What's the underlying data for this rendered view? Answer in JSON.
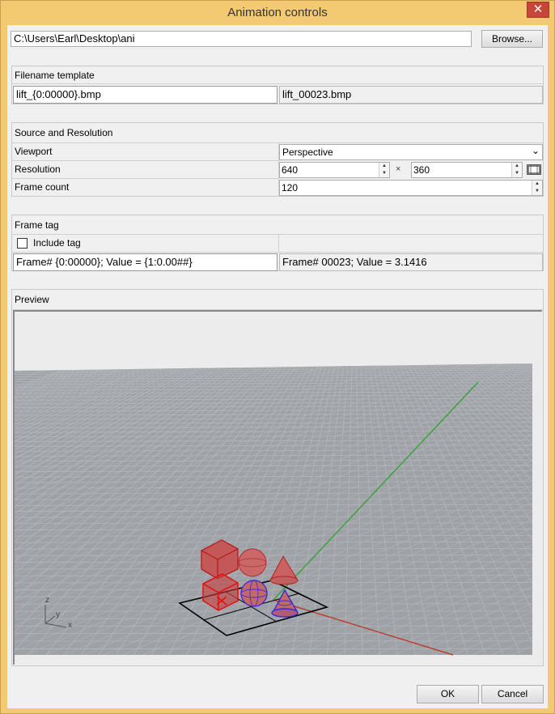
{
  "window": {
    "title": "Animation controls",
    "close_glyph": "✕"
  },
  "folder": {
    "path": "C:\\Users\\Earl\\Desktop\\ani",
    "browse_label": "Browse..."
  },
  "filename_template": {
    "header": "Filename template",
    "template_value": "lift_{0:00000}.bmp",
    "preview_value": "lift_00023.bmp"
  },
  "source": {
    "header": "Source and Resolution",
    "viewport_label": "Viewport",
    "viewport_value": "Perspective",
    "resolution_label": "Resolution",
    "width_value": "640",
    "times_sign": "×",
    "height_value": "360",
    "frame_count_label": "Frame count",
    "frame_count_value": "120"
  },
  "frame_tag": {
    "header": "Frame tag",
    "include_label": "Include tag",
    "include_checked": false,
    "format_value": "Frame# {0:00000};   Value = {1:0.00##}",
    "preview_value": "Frame# 00023;   Value = 3.1416"
  },
  "preview": {
    "header": "Preview",
    "axis_z": "z",
    "axis_y": "y",
    "axis_x": "x"
  },
  "buttons": {
    "ok": "OK",
    "cancel": "Cancel"
  },
  "colors": {
    "frame": "#f3c972",
    "close": "#c7463a",
    "grid_floor": "#9a9ea3",
    "object_red": "#c02020",
    "object_blue": "#3a2ad0",
    "axis_green": "#2ea32e",
    "axis_red": "#c03020"
  }
}
